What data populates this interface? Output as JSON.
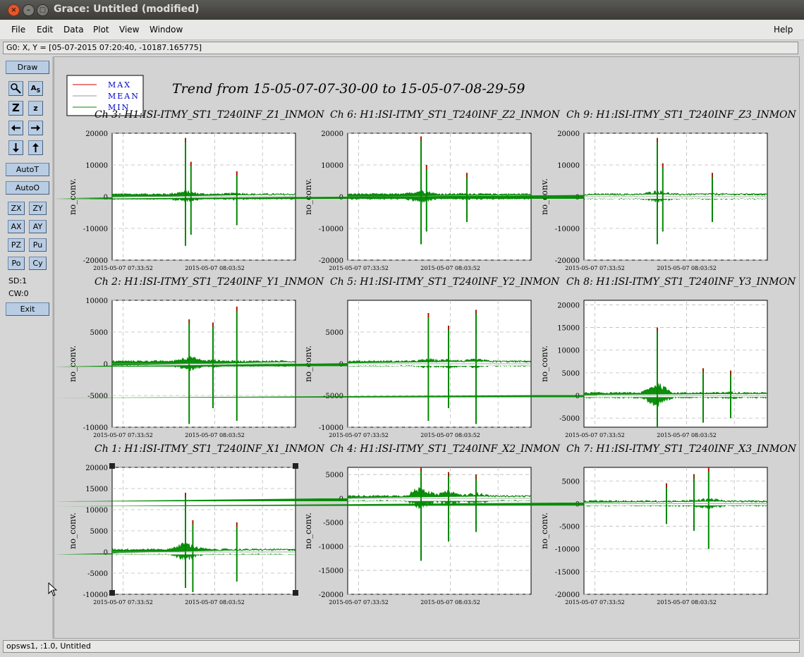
{
  "window": {
    "title": "Grace: Untitled (modified)"
  },
  "menu": {
    "file": "File",
    "edit": "Edit",
    "data": "Data",
    "plot": "Plot",
    "view": "View",
    "window": "Window",
    "help": "Help"
  },
  "locator": "G0: X, Y = [05-07-2015 07:20:40, -10187.165775]",
  "toolbar": {
    "draw": "Draw",
    "autot": "AutoT",
    "autoo": "AutoO",
    "zx": "ZX",
    "zy": "ZY",
    "ax": "AX",
    "ay": "AY",
    "pz": "PZ",
    "pu": "Pu",
    "po": "Po",
    "cy": "Cy",
    "sd": "SD:1",
    "cw": "CW:0",
    "exit": "Exit",
    "icons": [
      "zoom-icon",
      "autoscale-text-icon",
      "zoom-in-icon",
      "zoom-out-icon",
      "scroll-left-icon",
      "scroll-right-icon",
      "scroll-down-icon",
      "scroll-up-icon"
    ]
  },
  "status": "opsws1, :1.0, Untitled",
  "canvas": {
    "title": "Trend from 15-05-07-07-30-00 to 15-05-07-08-29-59",
    "legend": [
      {
        "label": "MAX",
        "color": "#cc0000"
      },
      {
        "label": "MEAN",
        "color": "#999999"
      },
      {
        "label": "MIN",
        "color": "#008800"
      }
    ]
  },
  "chart_data": [
    {
      "type": "line",
      "title": "Ch 3: H1:ISI-ITMY_ST1_T240INF_Z1_INMON",
      "ylabel": "no_conv.",
      "ylim": [
        -20000,
        20000
      ],
      "yticks": [
        -20000,
        -10000,
        0,
        10000,
        20000
      ],
      "xticks": [
        "2015-05-07 07:33:52",
        "2015-05-07 08:03:52"
      ],
      "spikes": [
        [
          0.4,
          18500,
          -15500
        ],
        [
          0.43,
          11000,
          -12000
        ],
        [
          0.68,
          8000,
          -9000
        ]
      ]
    },
    {
      "type": "line",
      "title": "Ch 6: H1:ISI-ITMY_ST1_T240INF_Z2_INMON",
      "ylabel": "no_conv.",
      "ylim": [
        -20000,
        20000
      ],
      "yticks": [
        -20000,
        -10000,
        0,
        10000,
        20000
      ],
      "xticks": [
        "2015-05-07 07:33:52",
        "2015-05-07 08:03:52"
      ],
      "spikes": [
        [
          0.4,
          19000,
          -15000
        ],
        [
          0.43,
          10000,
          -11000
        ],
        [
          0.65,
          7500,
          -8000
        ]
      ]
    },
    {
      "type": "line",
      "title": "Ch 9: H1:ISI-ITMY_ST1_T240INF_Z3_INMON",
      "ylabel": "no_conv.",
      "ylim": [
        -20000,
        20000
      ],
      "yticks": [
        -20000,
        -10000,
        0,
        10000,
        20000
      ],
      "xticks": [
        "2015-05-07 07:33:52",
        "2015-05-07 08:03:52"
      ],
      "spikes": [
        [
          0.4,
          18500,
          -15000
        ],
        [
          0.43,
          10500,
          -11000
        ],
        [
          0.7,
          7500,
          -8000
        ]
      ]
    },
    {
      "type": "line",
      "title": "Ch 2: H1:ISI-ITMY_ST1_T240INF_Y1_INMON",
      "ylabel": "no_conv.",
      "ylim": [
        -10000,
        10000
      ],
      "yticks": [
        -10000,
        -5000,
        0,
        5000,
        10000
      ],
      "xticks": [
        "2015-05-07 07:33:52",
        "2015-05-07 08:03:52"
      ],
      "spikes": [
        [
          0.42,
          7000,
          -9500
        ],
        [
          0.68,
          9000,
          -9000
        ],
        [
          0.55,
          6500,
          -7000
        ]
      ]
    },
    {
      "type": "line",
      "title": "Ch 5: H1:ISI-ITMY_ST1_T240INF_Y2_INMON",
      "ylabel": "no_conv.",
      "ylim": [
        -10000,
        10000
      ],
      "yticks": [
        -10000,
        -5000,
        0,
        5000
      ],
      "xticks": [
        "2015-05-07 07:33:52",
        "2015-05-07 08:03:52"
      ],
      "spikes": [
        [
          0.44,
          8000,
          -9000
        ],
        [
          0.7,
          8500,
          -9500
        ],
        [
          0.55,
          6000,
          -7000
        ]
      ]
    },
    {
      "type": "line",
      "title": "Ch 8: H1:ISI-ITMY_ST1_T240INF_Y3_INMON",
      "ylabel": "no_conv.",
      "ylim": [
        -7000,
        21000
      ],
      "yticks": [
        -5000,
        0,
        5000,
        10000,
        15000,
        20000
      ],
      "xticks": [
        "2015-05-07 07:33:52",
        "2015-05-07 08:03:52"
      ],
      "spikes": [
        [
          0.4,
          15000,
          -7500
        ],
        [
          0.65,
          6000,
          -6000
        ],
        [
          0.8,
          5500,
          -5000
        ]
      ]
    },
    {
      "type": "line",
      "title": "Ch 1: H1:ISI-ITMY_ST1_T240INF_X1_INMON",
      "ylabel": "no_conv.",
      "ylim": [
        -10000,
        20000
      ],
      "yticks": [
        -10000,
        -5000,
        0,
        5000,
        10000,
        15000,
        20000
      ],
      "xticks": [
        "2015-05-07 07:33:52",
        "2015-05-07 08:03:52"
      ],
      "spikes": [
        [
          0.4,
          14000,
          -8500
        ],
        [
          0.44,
          7500,
          -9500
        ],
        [
          0.68,
          7000,
          -7000
        ]
      ]
    },
    {
      "type": "line",
      "title": "Ch 4: H1:ISI-ITMY_ST1_T240INF_X2_INMON",
      "ylabel": "no_conv.",
      "ylim": [
        -20000,
        6500
      ],
      "yticks": [
        -20000,
        -15000,
        -10000,
        -5000,
        0,
        5000
      ],
      "xticks": [
        "2015-05-07 07:33:52",
        "2015-05-07 08:03:52"
      ],
      "spikes": [
        [
          0.4,
          6500,
          -13000
        ],
        [
          0.55,
          5500,
          -9000
        ],
        [
          0.7,
          5000,
          -7000
        ]
      ]
    },
    {
      "type": "line",
      "title": "Ch 7: H1:ISI-ITMY_ST1_T240INF_X3_INMON",
      "ylabel": "no_conv.",
      "ylim": [
        -20000,
        8000
      ],
      "yticks": [
        -20000,
        -15000,
        -10000,
        -5000,
        0,
        5000
      ],
      "xticks": [
        "2015-05-07 07:33:52",
        "2015-05-07 08:03:52"
      ],
      "spikes": [
        [
          0.68,
          8000,
          -10000
        ],
        [
          0.6,
          6500,
          -6000
        ],
        [
          0.45,
          4500,
          -4500
        ]
      ]
    }
  ]
}
